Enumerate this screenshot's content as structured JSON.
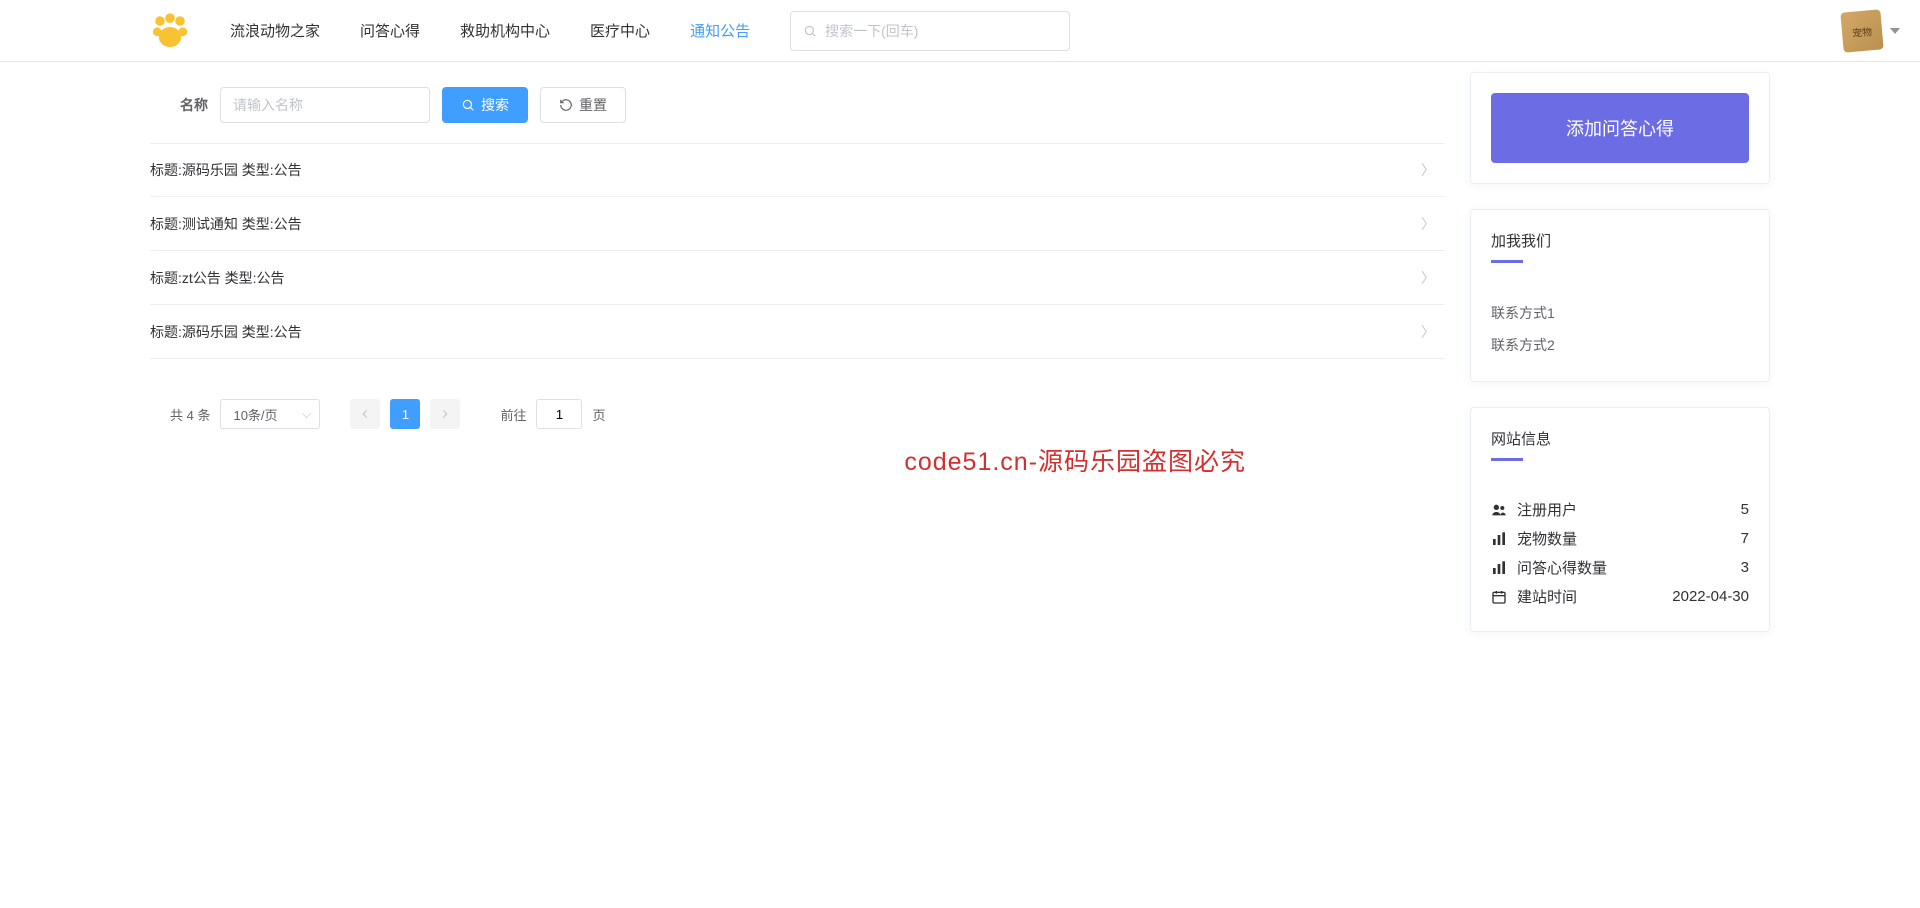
{
  "header": {
    "nav": [
      {
        "label": "流浪动物之家",
        "active": false
      },
      {
        "label": "问答心得",
        "active": false
      },
      {
        "label": "救助机构中心",
        "active": false
      },
      {
        "label": "医疗中心",
        "active": false
      },
      {
        "label": "通知公告",
        "active": true
      }
    ],
    "search_placeholder": "搜索一下(回车)"
  },
  "filter": {
    "label": "名称",
    "input_placeholder": "请输入名称",
    "search_btn": "搜索",
    "reset_btn": "重置"
  },
  "list_items": [
    "标题:源码乐园 类型:公告",
    "标题:测试通知 类型:公告",
    "标题:zt公告 类型:公告",
    "标题:源码乐园 类型:公告"
  ],
  "pagination": {
    "total_label": "共 4 条",
    "page_size_label": "10条/页",
    "current_page": "1",
    "goto_prefix": "前往",
    "goto_suffix": "页",
    "goto_value": "1"
  },
  "sidebar": {
    "add_btn": "添加问答心得",
    "join_title": "加我我们",
    "contacts": [
      "联系方式1",
      "联系方式2"
    ],
    "info_title": "网站信息",
    "stats": [
      {
        "icon": "users",
        "label": "注册用户",
        "value": "5"
      },
      {
        "icon": "chart",
        "label": "宠物数量",
        "value": "7"
      },
      {
        "icon": "chart",
        "label": "问答心得数量",
        "value": "3"
      },
      {
        "icon": "calendar",
        "label": "建站时间",
        "value": "2022-04-30"
      }
    ]
  },
  "watermark": "code51.cn-源码乐园盗图必究"
}
